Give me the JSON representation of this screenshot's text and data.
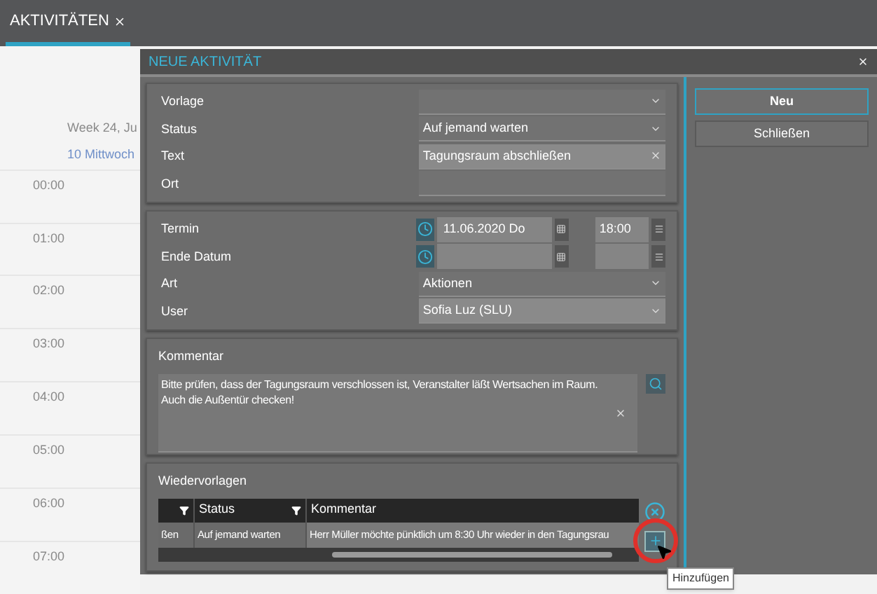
{
  "tabs": [
    {
      "label": "AKTIVITÄTEN",
      "selected": true
    }
  ],
  "calendar": {
    "week_label": "Week 24, Ju",
    "day_label": "10 Mittwoch",
    "times": [
      "00:00",
      "01:00",
      "02:00",
      "03:00",
      "04:00",
      "05:00",
      "06:00",
      "07:00"
    ]
  },
  "dialog": {
    "title": "NEUE AKTIVITÄT",
    "sections": [
      {
        "kind": "fields",
        "fields": [
          {
            "label": "Vorlage",
            "kind": "dropdown",
            "filled": false
          },
          {
            "label": "Status",
            "kind": "dropdown",
            "value": "Auf jemand warten",
            "filled": false
          },
          {
            "label": "Text",
            "kind": "text",
            "value": "Tagungsraum abschließen",
            "filled": true
          },
          {
            "label": "Ort",
            "kind": "text",
            "filled": false
          }
        ]
      },
      {
        "kind": "fields",
        "fields": [
          {
            "label": "Termin",
            "kind": "datetime",
            "date": "11.06.2020 Do",
            "time": "18:00"
          },
          {
            "label": "Ende Datum",
            "kind": "datetime"
          },
          {
            "label": "Art",
            "kind": "dropdown",
            "value": "Aktionen",
            "filled": false
          },
          {
            "label": "User",
            "kind": "dropdown",
            "value": "Sofia Luz (SLU)",
            "filled": true
          }
        ]
      },
      {
        "kind": "comment",
        "title": "Kommentar",
        "text": "Bitte prüfen, dass der Tagungsraum verschlossen ist, Veranstalter läßt Wertsachen im Raum.\nAuch die Außentür checken!"
      },
      {
        "kind": "table",
        "title": "Wiedervorlagen",
        "columns": [
          {
            "filter": true
          },
          {
            "label": "Status",
            "filter": true
          },
          {
            "label": "Kommentar",
            "filter": false
          }
        ],
        "rows": [
          [
            "ßen",
            "Auf jemand warten",
            "Herr Müller möchte pünktlich um 8:30 Uhr wieder in den Tagungsrau"
          ]
        ]
      }
    ],
    "buttons": [
      {
        "label": "Neu",
        "selected": true
      },
      {
        "label": "Schließen",
        "selected": false
      }
    ],
    "tooltip": "Hinzufügen"
  }
}
